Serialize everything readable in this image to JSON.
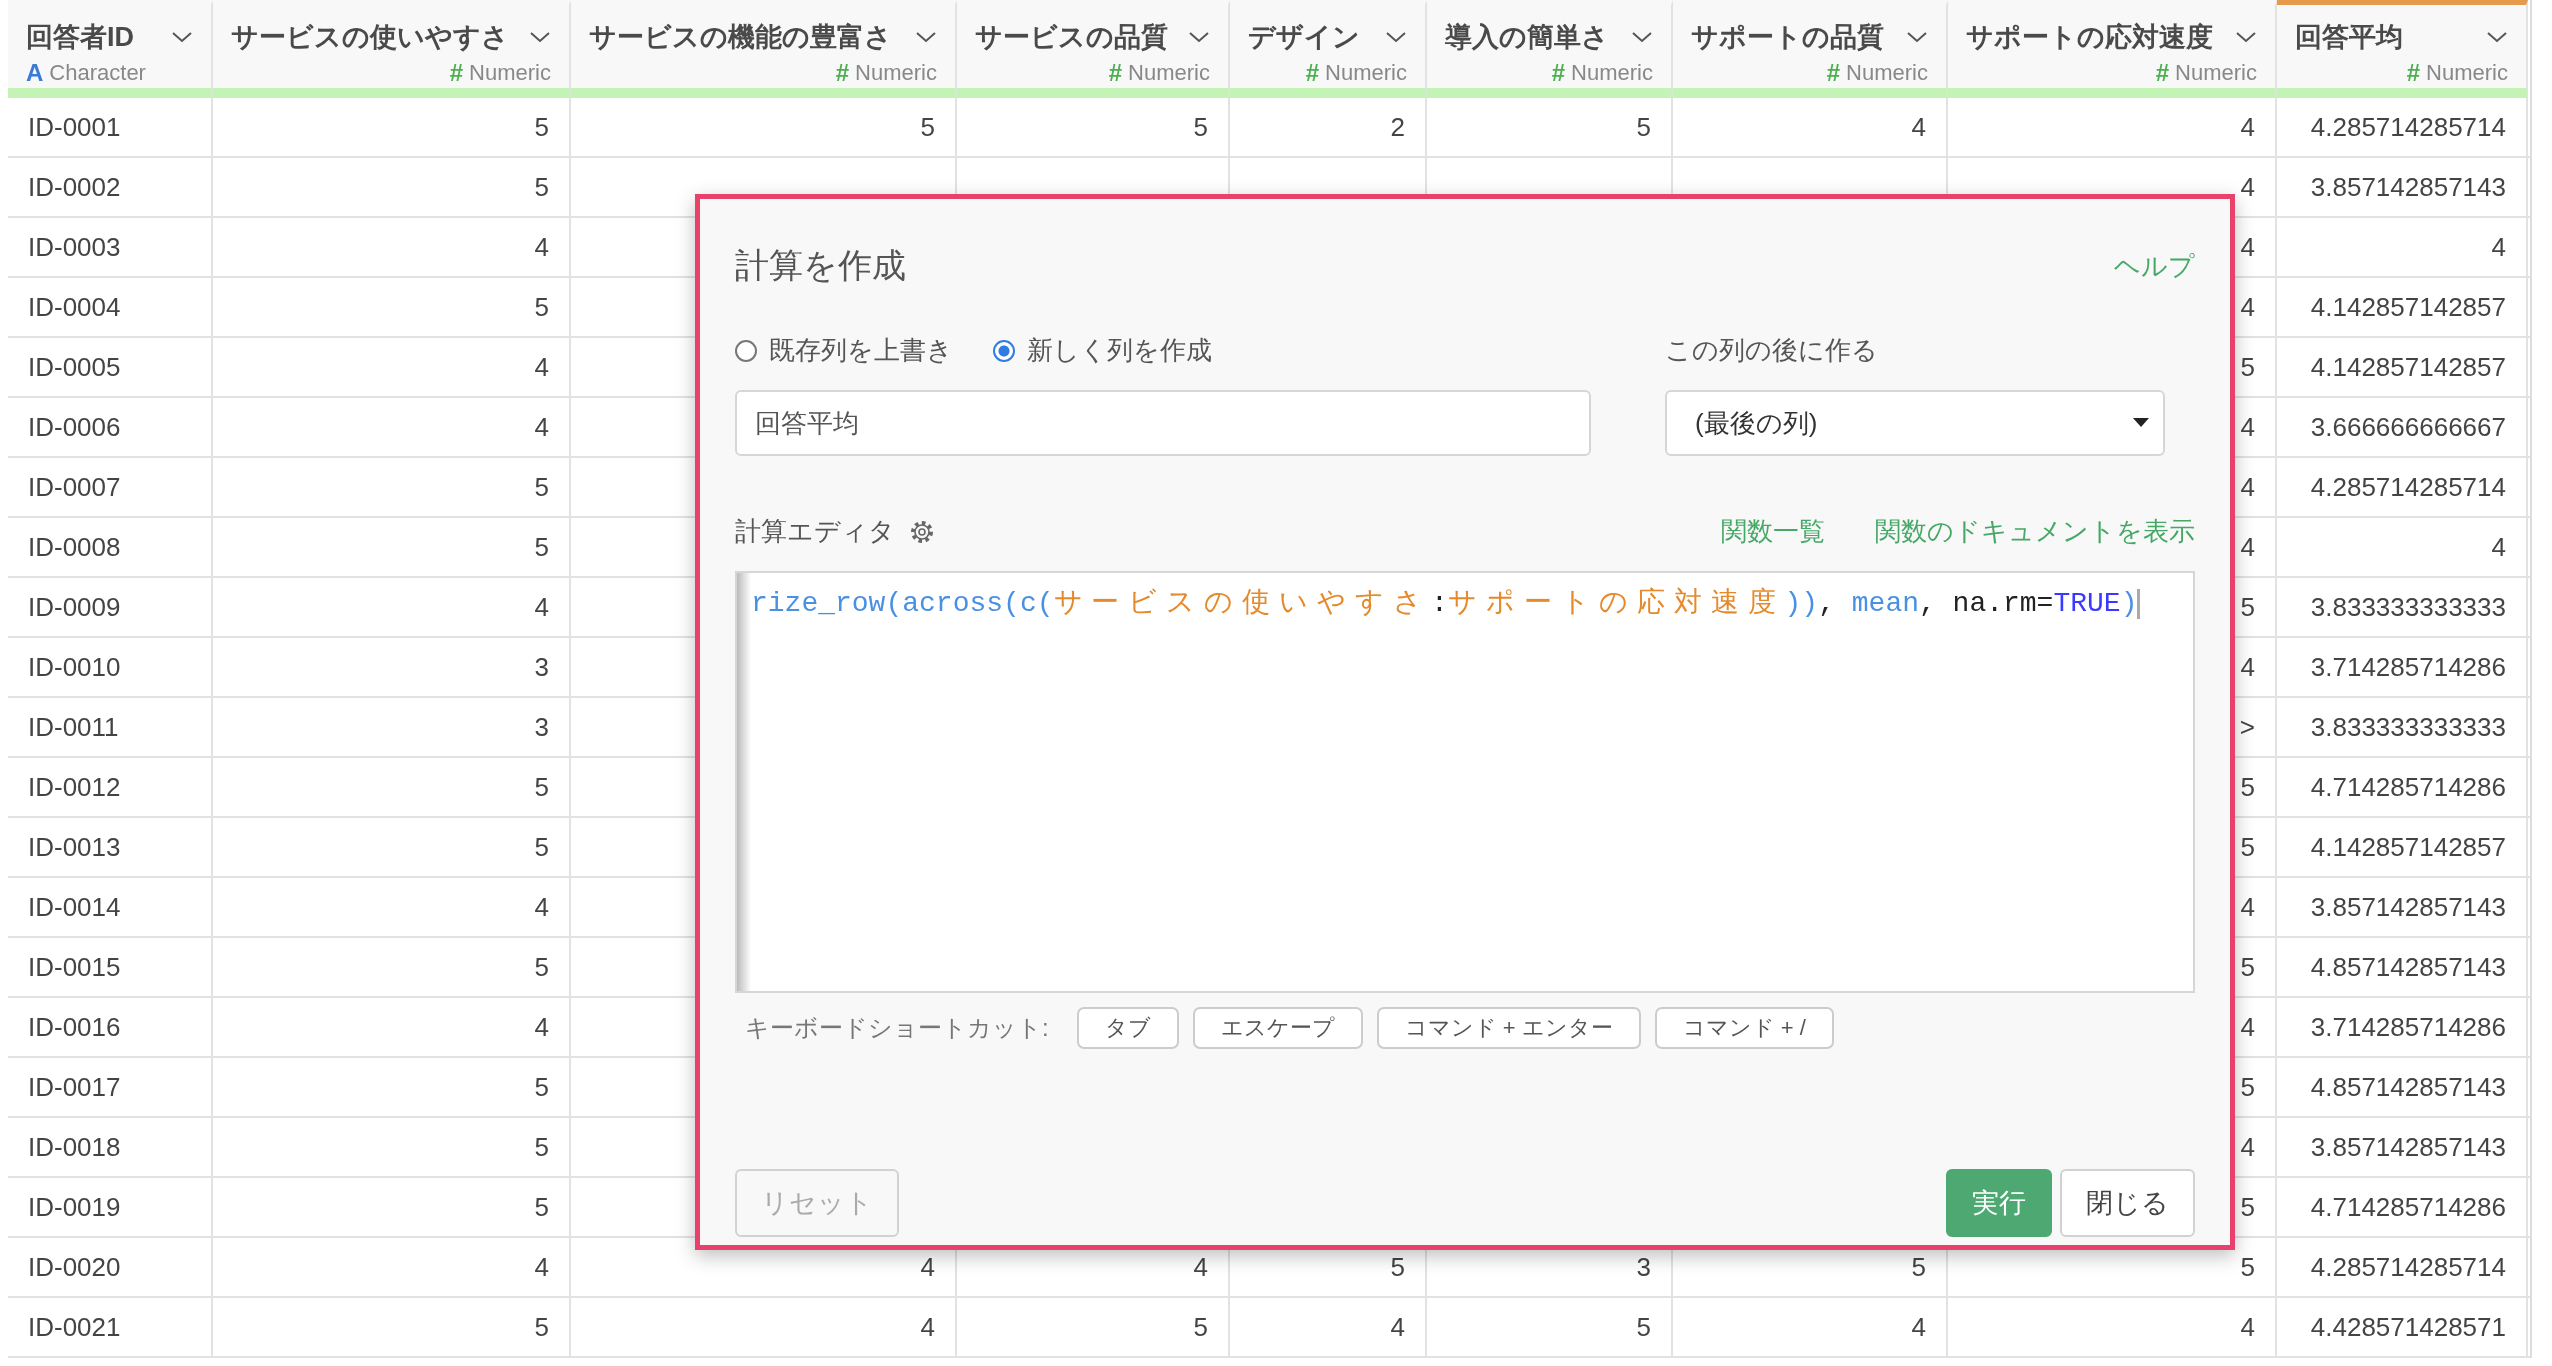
{
  "table": {
    "columns": [
      {
        "name": "回答者ID",
        "type_icon": "A",
        "kind": "character",
        "type": "Character",
        "selected": false
      },
      {
        "name": "サービスの使いやすさ",
        "type_icon": "#",
        "kind": "numeric",
        "type": "Numeric",
        "selected": false
      },
      {
        "name": "サービスの機能の豊富さ",
        "type_icon": "#",
        "kind": "numeric",
        "type": "Numeric",
        "selected": false
      },
      {
        "name": "サービスの品質",
        "type_icon": "#",
        "kind": "numeric",
        "type": "Numeric",
        "selected": false
      },
      {
        "name": "デザイン",
        "type_icon": "#",
        "kind": "numeric",
        "type": "Numeric",
        "selected": false
      },
      {
        "name": "導入の簡単さ",
        "type_icon": "#",
        "kind": "numeric",
        "type": "Numeric",
        "selected": false
      },
      {
        "name": "サポートの品質",
        "type_icon": "#",
        "kind": "numeric",
        "type": "Numeric",
        "selected": false
      },
      {
        "name": "サポートの応対速度",
        "type_icon": "#",
        "kind": "numeric",
        "type": "Numeric",
        "selected": false
      },
      {
        "name": "回答平均",
        "type_icon": "#",
        "kind": "numeric",
        "type": "Numeric",
        "selected": true
      }
    ],
    "rows": [
      {
        "cells": [
          "ID-0001",
          "5",
          "5",
          "5",
          "2",
          "5",
          "4",
          "4",
          "4.285714285714"
        ]
      },
      {
        "cells": [
          "ID-0002",
          "5",
          null,
          null,
          null,
          null,
          null,
          "4",
          "3.857142857143"
        ]
      },
      {
        "cells": [
          "ID-0003",
          "4",
          null,
          null,
          null,
          null,
          null,
          "4",
          "4"
        ]
      },
      {
        "cells": [
          "ID-0004",
          "5",
          null,
          null,
          null,
          null,
          null,
          "4",
          "4.142857142857"
        ]
      },
      {
        "cells": [
          "ID-0005",
          "4",
          null,
          null,
          null,
          null,
          null,
          "5",
          "4.142857142857"
        ]
      },
      {
        "cells": [
          "ID-0006",
          "4",
          null,
          null,
          null,
          null,
          null,
          "4",
          "3.666666666667"
        ]
      },
      {
        "cells": [
          "ID-0007",
          "5",
          null,
          null,
          null,
          null,
          null,
          "4",
          "4.285714285714"
        ]
      },
      {
        "cells": [
          "ID-0008",
          "5",
          null,
          null,
          null,
          null,
          null,
          "4",
          "4"
        ]
      },
      {
        "cells": [
          "ID-0009",
          "4",
          null,
          null,
          null,
          null,
          null,
          "5",
          "3.833333333333"
        ]
      },
      {
        "cells": [
          "ID-0010",
          "3",
          null,
          null,
          null,
          null,
          null,
          "4",
          "3.714285714286"
        ]
      },
      {
        "cells": [
          "ID-0011",
          "3",
          null,
          null,
          null,
          null,
          null,
          ">",
          "3.833333333333"
        ]
      },
      {
        "cells": [
          "ID-0012",
          "5",
          null,
          null,
          null,
          null,
          null,
          "5",
          "4.714285714286"
        ]
      },
      {
        "cells": [
          "ID-0013",
          "5",
          null,
          null,
          null,
          null,
          null,
          "5",
          "4.142857142857"
        ]
      },
      {
        "cells": [
          "ID-0014",
          "4",
          null,
          null,
          null,
          null,
          null,
          "4",
          "3.857142857143"
        ]
      },
      {
        "cells": [
          "ID-0015",
          "5",
          null,
          null,
          null,
          null,
          null,
          "5",
          "4.857142857143"
        ]
      },
      {
        "cells": [
          "ID-0016",
          "4",
          null,
          null,
          null,
          null,
          null,
          "4",
          "3.714285714286"
        ]
      },
      {
        "cells": [
          "ID-0017",
          "5",
          null,
          null,
          null,
          null,
          null,
          "5",
          "4.857142857143"
        ]
      },
      {
        "cells": [
          "ID-0018",
          "5",
          null,
          null,
          null,
          null,
          null,
          "4",
          "3.857142857143"
        ]
      },
      {
        "cells": [
          "ID-0019",
          "5",
          null,
          null,
          null,
          null,
          null,
          "5",
          "4.714285714286"
        ]
      },
      {
        "cells": [
          "ID-0020",
          "4",
          "4",
          "4",
          "5",
          "3",
          "5",
          "5",
          "4.285714285714"
        ]
      },
      {
        "cells": [
          "ID-0021",
          "5",
          "4",
          "5",
          "4",
          "5",
          "4",
          "4",
          "4.428571428571"
        ]
      }
    ]
  },
  "dialog": {
    "title": "計算を作成",
    "help_link": "ヘルプ",
    "mode_options": [
      {
        "label": "既存列を上書き",
        "selected": false
      },
      {
        "label": "新しく列を作成",
        "selected": true
      }
    ],
    "name_field": {
      "value": "回答平均"
    },
    "position_label": "この列の後に作る",
    "position_select": {
      "value": "(最後の列)"
    },
    "editor_label": "計算エディタ",
    "editor_links": [
      "関数一覧",
      "関数のドキュメントを表示"
    ],
    "code_tokens": [
      {
        "kind": "function",
        "text": "rize_row"
      },
      {
        "kind": "punct",
        "text": "("
      },
      {
        "kind": "function",
        "text": "across"
      },
      {
        "kind": "punct",
        "text": "("
      },
      {
        "kind": "function",
        "text": "c"
      },
      {
        "kind": "punct",
        "text": "("
      },
      {
        "kind": "column",
        "text": "サービスの使いやすさ"
      },
      {
        "kind": "plain",
        "text": ":"
      },
      {
        "kind": "column",
        "text": "サポートの応対速度"
      },
      {
        "kind": "punct",
        "text": "))"
      },
      {
        "kind": "plain",
        "text": ", "
      },
      {
        "kind": "function",
        "text": "mean"
      },
      {
        "kind": "plain",
        "text": ", na.rm="
      },
      {
        "kind": "constant",
        "text": "TRUE"
      },
      {
        "kind": "punct",
        "text": ")"
      }
    ],
    "shortcuts_label": "キーボードショートカット:",
    "shortcuts": [
      "タブ",
      "エスケープ",
      "コマンド + エンター",
      "コマンド + /"
    ],
    "buttons": [
      {
        "kind": "reset",
        "label": "リセット"
      },
      {
        "kind": "primary",
        "label": "実行"
      },
      {
        "kind": "secondary",
        "label": "閉じる"
      }
    ]
  }
}
